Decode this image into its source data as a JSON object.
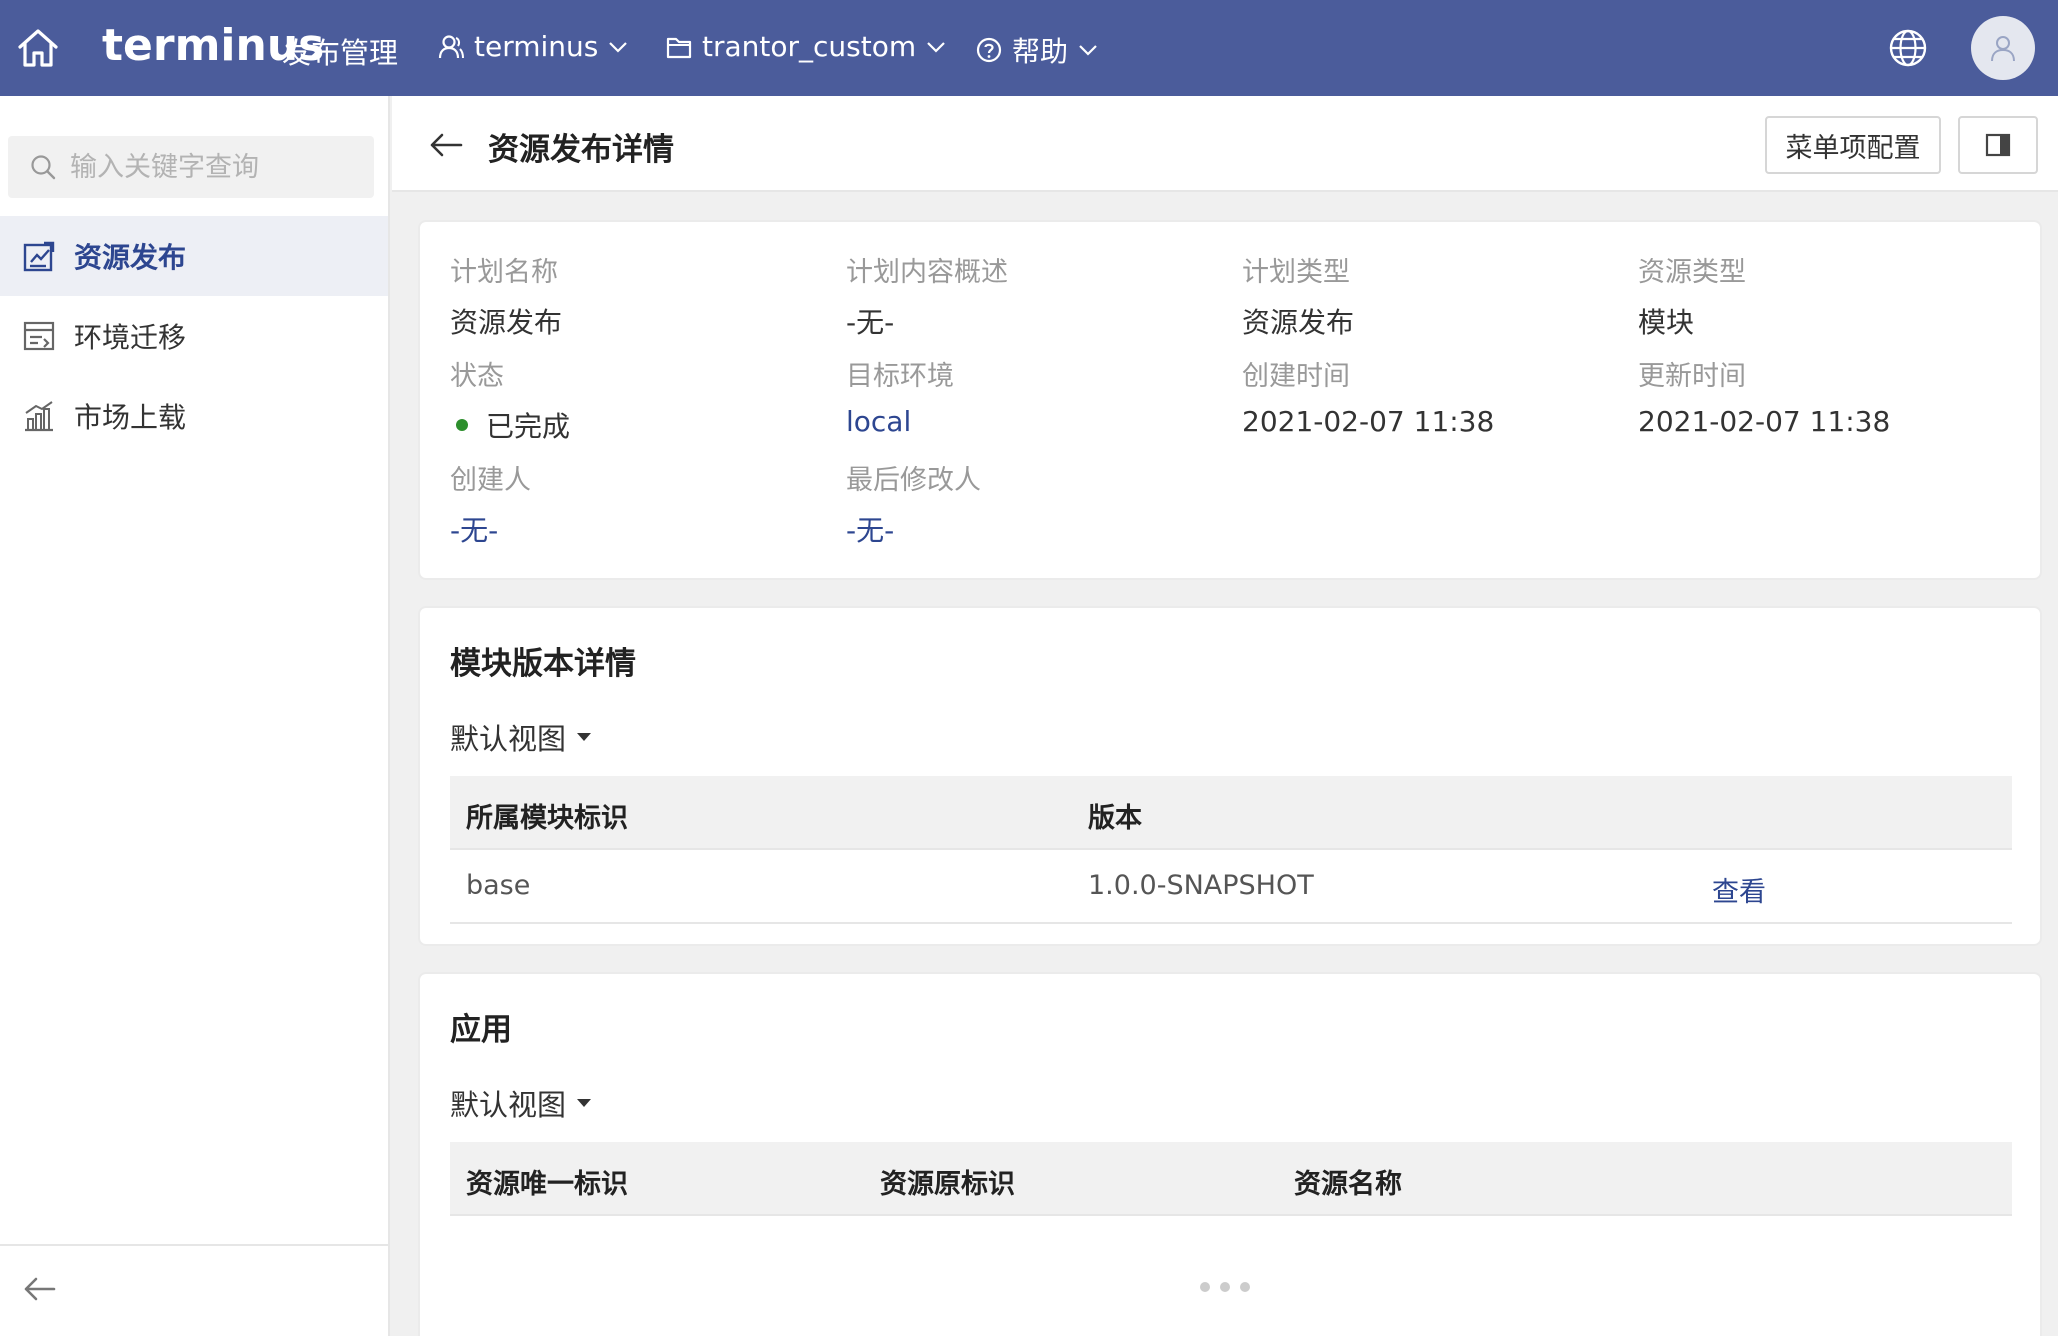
{
  "header": {
    "logo": "terminus",
    "app_name": "发布管理",
    "nav": {
      "org": "terminus",
      "project": "trantor_custom",
      "help": "帮助"
    }
  },
  "sidebar": {
    "search_placeholder": "输入关键字查询",
    "items": [
      {
        "label": "资源发布",
        "active": true
      },
      {
        "label": "环境迁移",
        "active": false
      },
      {
        "label": "市场上载",
        "active": false
      }
    ]
  },
  "page": {
    "title": "资源发布详情",
    "menu_config_button": "菜单项配置"
  },
  "details": {
    "plan_name": {
      "label": "计划名称",
      "value": "资源发布"
    },
    "plan_desc": {
      "label": "计划内容概述",
      "value": "-无-"
    },
    "plan_type": {
      "label": "计划类型",
      "value": "资源发布"
    },
    "resource_type": {
      "label": "资源类型",
      "value": "模块"
    },
    "status": {
      "label": "状态",
      "value": "已完成",
      "color": "#2d8f2d"
    },
    "target_env": {
      "label": "目标环境",
      "value": "local"
    },
    "created_at": {
      "label": "创建时间",
      "value": "2021-02-07 11:38"
    },
    "updated_at": {
      "label": "更新时间",
      "value": "2021-02-07 11:38"
    },
    "creator": {
      "label": "创建人",
      "value": "-无-"
    },
    "last_modifier": {
      "label": "最后修改人",
      "value": "-无-"
    }
  },
  "module_section": {
    "title": "模块版本详情",
    "view": "默认视图",
    "columns": [
      "所属模块标识",
      "版本"
    ],
    "rows": [
      {
        "module": "base",
        "version": "1.0.0-SNAPSHOT",
        "action": "查看"
      }
    ]
  },
  "app_section": {
    "title": "应用",
    "view": "默认视图",
    "columns": [
      "资源唯一标识",
      "资源原标识",
      "资源名称"
    ]
  },
  "colors": {
    "topbar": "#4b5c9b",
    "accent": "#2d4690"
  }
}
